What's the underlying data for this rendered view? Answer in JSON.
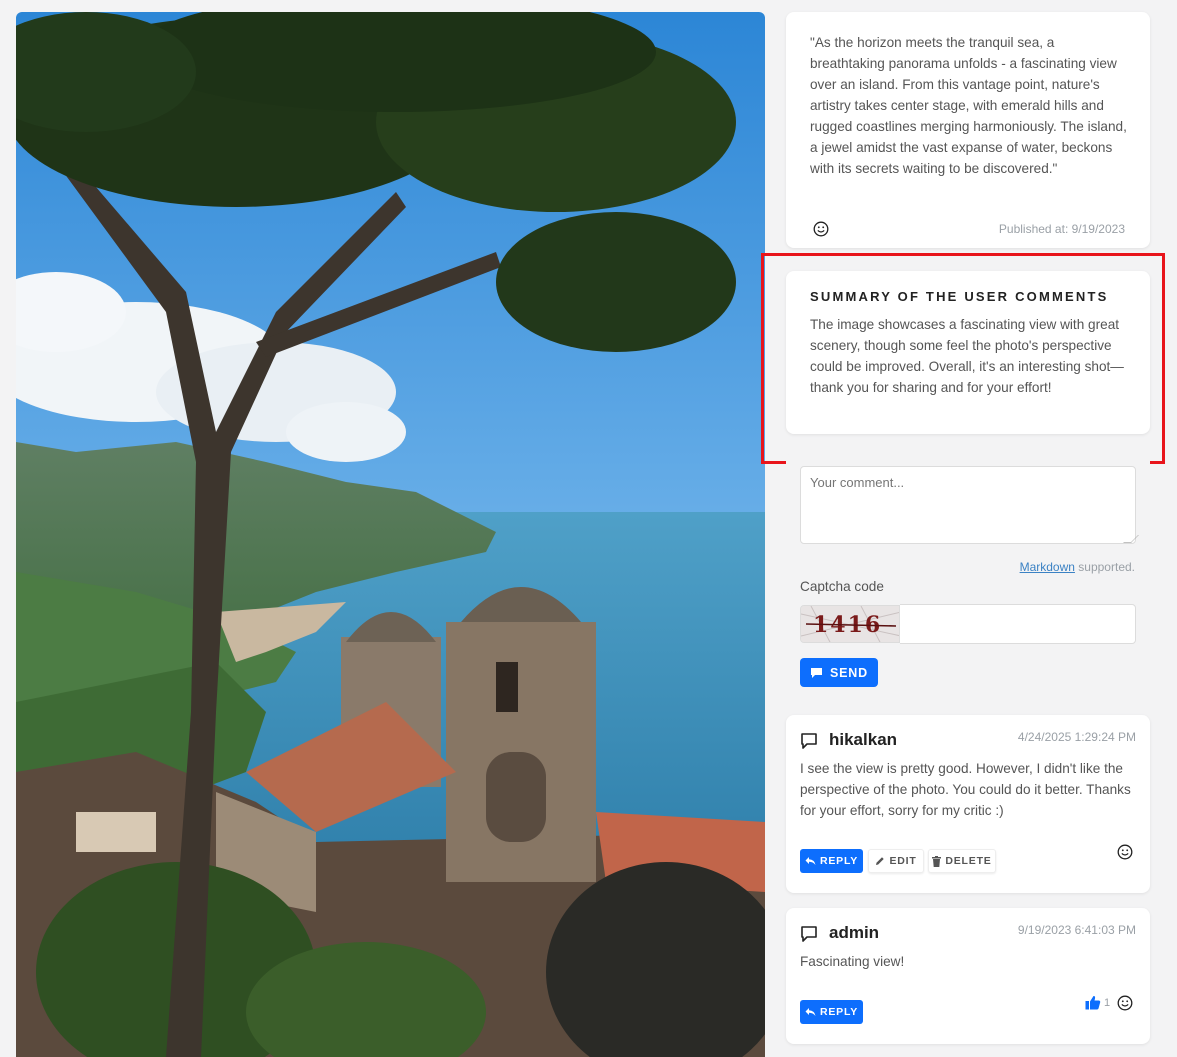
{
  "post": {
    "description": "\"As the horizon meets the tranquil sea, a breathtaking panorama unfolds - a fascinating view over an island. From this vantage point, nature's artistry takes center stage, with emerald hills and rugged coastlines merging harmoniously. The island, a jewel amidst the vast expanse of water, beckons with its secrets waiting to be discovered.\"",
    "published": "Published at: 9/19/2023"
  },
  "summary": {
    "title": "SUMMARY OF THE USER COMMENTS",
    "text": "The image showcases a fascinating view with great scenery, though some feel the photo's perspective could be improved. Overall, it's an interesting shot—thank you for sharing and for your effort!"
  },
  "form": {
    "comment_placeholder": "Your comment...",
    "markdown_link": "Markdown",
    "markdown_suffix": " supported.",
    "captcha_label": "Captcha code",
    "captcha_text": "1416",
    "send_label": "SEND"
  },
  "comments": [
    {
      "author": "hikalkan",
      "date": "4/24/2025 1:29:24 PM",
      "text": "I see the view is pretty good. However, I didn't like the perspective of the photo. You could do it better. Thanks for your effort, sorry for my critic :)",
      "reply_label": "REPLY",
      "edit_label": "EDIT",
      "delete_label": "DELETE"
    },
    {
      "author": "admin",
      "date": "9/19/2023 6:41:03 PM",
      "text": "Fascinating view!",
      "reply_label": "REPLY",
      "likes": "1"
    }
  ],
  "colors": {
    "accent": "#0d6efd",
    "highlight": "#e8141b",
    "background": "#f3f3f4"
  },
  "icons": [
    "smile-icon",
    "comment-icon",
    "send-icon",
    "reply-icon",
    "pencil-icon",
    "trash-icon",
    "thumbs-up-icon"
  ]
}
